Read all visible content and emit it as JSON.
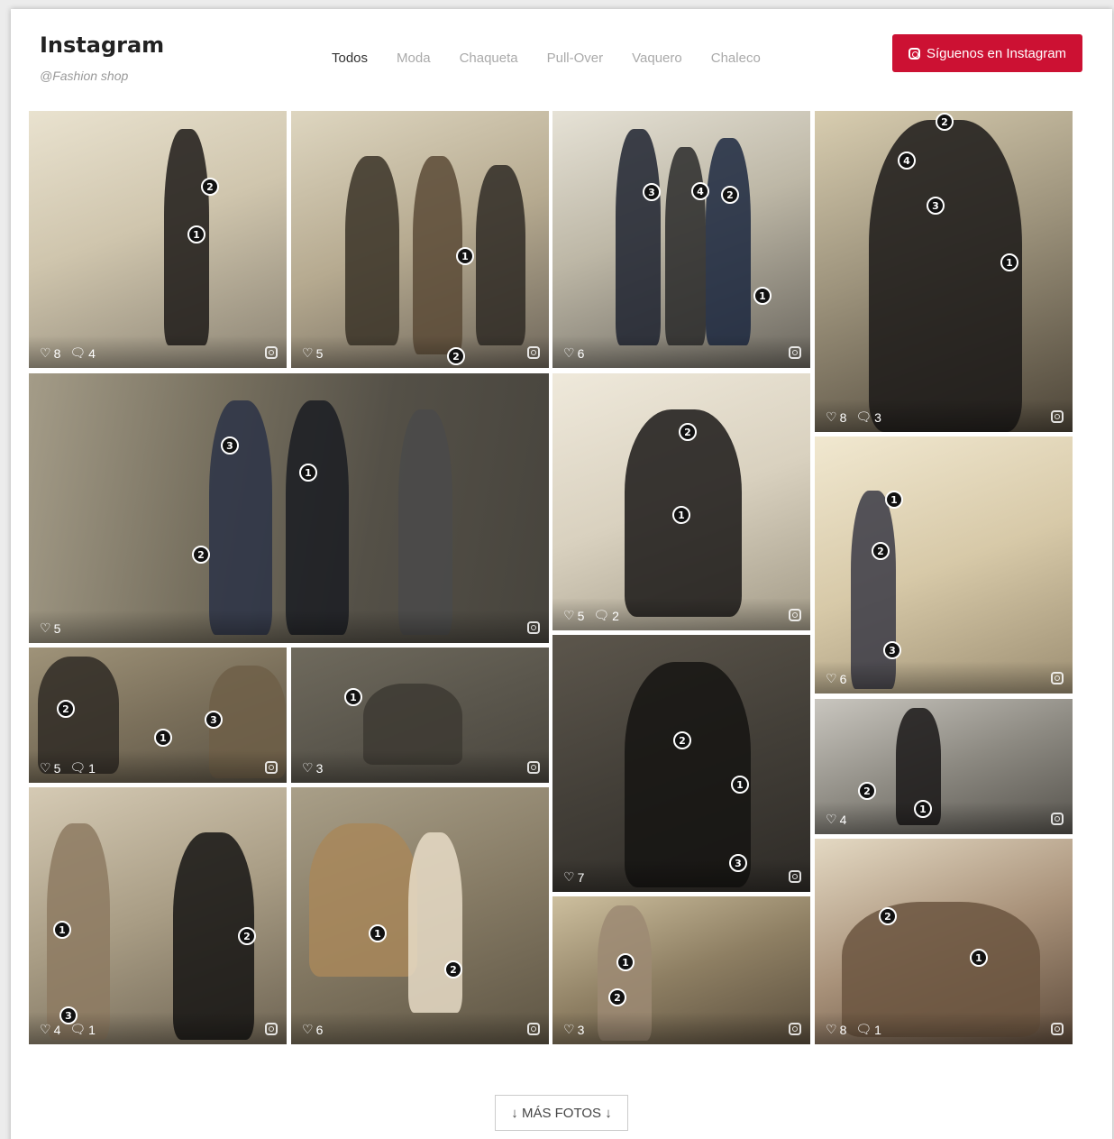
{
  "header": {
    "title": "Instagram",
    "handle": "@Fashion shop",
    "follow_label": "Síguenos en Instagram"
  },
  "filters": [
    "Todos",
    "Moda",
    "Chaqueta",
    "Pull-Over",
    "Vaquero",
    "Chaleco"
  ],
  "active_filter": "Todos",
  "tiles": [
    {
      "likes": "8",
      "comments": "4",
      "pins": [
        "2",
        "1"
      ]
    },
    {
      "likes": "5",
      "comments": "",
      "pins": [
        "1",
        "2"
      ]
    },
    {
      "likes": "6",
      "comments": "",
      "pins": [
        "3",
        "4",
        "2",
        "1"
      ]
    },
    {
      "likes": "8",
      "comments": "3",
      "pins": [
        "2",
        "4",
        "3",
        "1"
      ]
    },
    {
      "likes": "5",
      "comments": "",
      "pins": [
        "3",
        "1",
        "2"
      ]
    },
    {
      "likes": "5",
      "comments": "2",
      "pins": [
        "2",
        "1"
      ]
    },
    {
      "likes": "6",
      "comments": "",
      "pins": [
        "1",
        "2",
        "3"
      ]
    },
    {
      "likes": "5",
      "comments": "1",
      "pins": [
        "2",
        "3",
        "1"
      ]
    },
    {
      "likes": "3",
      "comments": "",
      "pins": [
        "1"
      ]
    },
    {
      "likes": "7",
      "comments": "",
      "pins": [
        "2",
        "1",
        "3"
      ]
    },
    {
      "likes": "4",
      "comments": "",
      "pins": [
        "2",
        "1"
      ]
    },
    {
      "likes": "4",
      "comments": "1",
      "pins": [
        "1",
        "2",
        "3"
      ]
    },
    {
      "likes": "6",
      "comments": "",
      "pins": [
        "1",
        "2"
      ]
    },
    {
      "likes": "3",
      "comments": "",
      "pins": [
        "1",
        "2"
      ]
    },
    {
      "likes": "8",
      "comments": "1",
      "pins": [
        "2",
        "1"
      ]
    }
  ],
  "more_label": "↓ MÁS FOTOS ↓",
  "icons": {
    "like": "heart-icon",
    "comment": "comment-icon",
    "instagram": "instagram-icon"
  }
}
